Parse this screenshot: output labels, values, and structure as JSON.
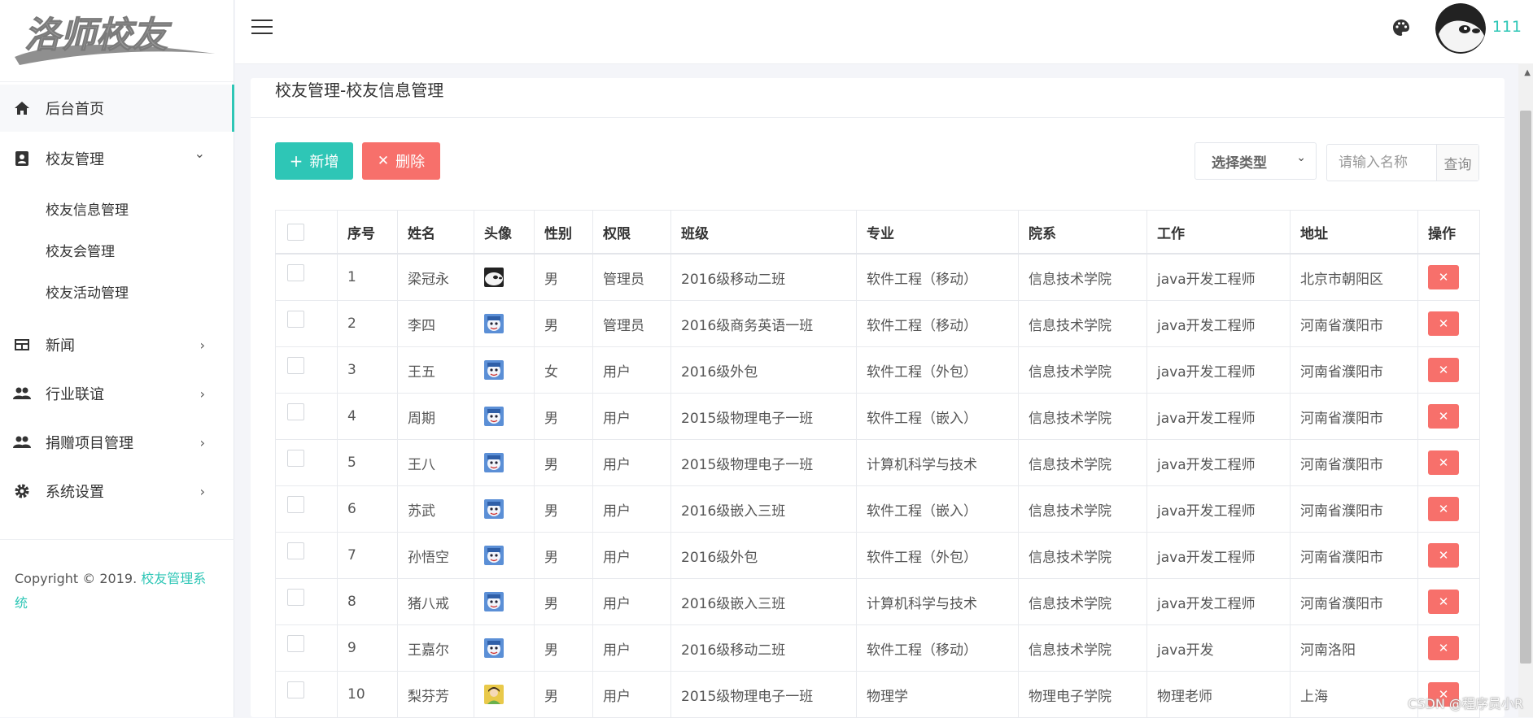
{
  "app": {
    "logo_text": "洛师校友",
    "username": "111"
  },
  "sidebar": {
    "items": [
      {
        "label": "后台首页",
        "icon": "home-icon"
      },
      {
        "label": "校友管理",
        "icon": "contacts-icon",
        "arrow": "⌄"
      },
      {
        "label": "新闻",
        "icon": "newspaper-icon",
        "arrow": "›"
      },
      {
        "label": "行业联谊",
        "icon": "people-icon",
        "arrow": "›"
      },
      {
        "label": "捐赠项目管理",
        "icon": "people-icon",
        "arrow": "›"
      },
      {
        "label": "系统设置",
        "icon": "gear-icon",
        "arrow": "›"
      }
    ],
    "sub_items": [
      "校友信息管理",
      "校友会管理",
      "校友活动管理"
    ],
    "copyright_prefix": "Copyright © 2019. ",
    "copyright_brand": "校友管理系统"
  },
  "page": {
    "title": "校友管理-校友信息管理"
  },
  "toolbar": {
    "add_icon": "+",
    "add_label": "新增",
    "delete_icon": "✕",
    "delete_label": "删除",
    "type_select": "选择类型",
    "search_placeholder": "请输入名称",
    "search_button": "查询"
  },
  "table": {
    "columns": [
      "序号",
      "姓名",
      "头像",
      "性别",
      "权限",
      "班级",
      "专业",
      "院系",
      "工作",
      "地址",
      "操作"
    ],
    "rows": [
      {
        "no": "1",
        "name": "梁冠永",
        "avatar": "panda",
        "gender": "男",
        "role": "管理员",
        "class": "2016级移动二班",
        "major": "软件工程（移动）",
        "dept": "信息技术学院",
        "job": "java开发工程师",
        "addr": "北京市朝阳区"
      },
      {
        "no": "2",
        "name": "李四",
        "avatar": "cartoon",
        "gender": "男",
        "role": "管理员",
        "class": "2016级商务英语一班",
        "major": "软件工程（移动）",
        "dept": "信息技术学院",
        "job": "java开发工程师",
        "addr": "河南省濮阳市"
      },
      {
        "no": "3",
        "name": "王五",
        "avatar": "cartoon",
        "gender": "女",
        "role": "用户",
        "class": "2016级外包",
        "major": "软件工程（外包）",
        "dept": "信息技术学院",
        "job": "java开发工程师",
        "addr": "河南省濮阳市"
      },
      {
        "no": "4",
        "name": "周期",
        "avatar": "cartoon",
        "gender": "男",
        "role": "用户",
        "class": "2015级物理电子一班",
        "major": "软件工程（嵌入）",
        "dept": "信息技术学院",
        "job": "java开发工程师",
        "addr": "河南省濮阳市"
      },
      {
        "no": "5",
        "name": "王八",
        "avatar": "cartoon",
        "gender": "男",
        "role": "用户",
        "class": "2015级物理电子一班",
        "major": "计算机科学与技术",
        "dept": "信息技术学院",
        "job": "java开发工程师",
        "addr": "河南省濮阳市"
      },
      {
        "no": "6",
        "name": "苏武",
        "avatar": "cartoon",
        "gender": "男",
        "role": "用户",
        "class": "2016级嵌入三班",
        "major": "软件工程（嵌入）",
        "dept": "信息技术学院",
        "job": "java开发工程师",
        "addr": "河南省濮阳市"
      },
      {
        "no": "7",
        "name": "孙悟空",
        "avatar": "cartoon",
        "gender": "男",
        "role": "用户",
        "class": "2016级外包",
        "major": "软件工程（外包）",
        "dept": "信息技术学院",
        "job": "java开发工程师",
        "addr": "河南省濮阳市"
      },
      {
        "no": "8",
        "name": "猪八戒",
        "avatar": "cartoon",
        "gender": "男",
        "role": "用户",
        "class": "2016级嵌入三班",
        "major": "计算机科学与技术",
        "dept": "信息技术学院",
        "job": "java开发工程师",
        "addr": "河南省濮阳市"
      },
      {
        "no": "9",
        "name": "王嘉尔",
        "avatar": "cartoon",
        "gender": "男",
        "role": "用户",
        "class": "2016级移动二班",
        "major": "软件工程（移动）",
        "dept": "信息技术学院",
        "job": "java开发",
        "addr": "河南洛阳"
      },
      {
        "no": "10",
        "name": "梨芬芳",
        "avatar": "photo",
        "gender": "男",
        "role": "用户",
        "class": "2015级物理电子一班",
        "major": "物理学",
        "dept": "物理电子学院",
        "job": "物理老师",
        "addr": "上海"
      }
    ],
    "delete_glyph": "✕"
  },
  "watermark": "CSDN @程序员小R",
  "colors": {
    "accent": "#2ec6b6",
    "danger": "#f7706b",
    "border": "#e8eaee",
    "background": "#f4f5f9"
  }
}
